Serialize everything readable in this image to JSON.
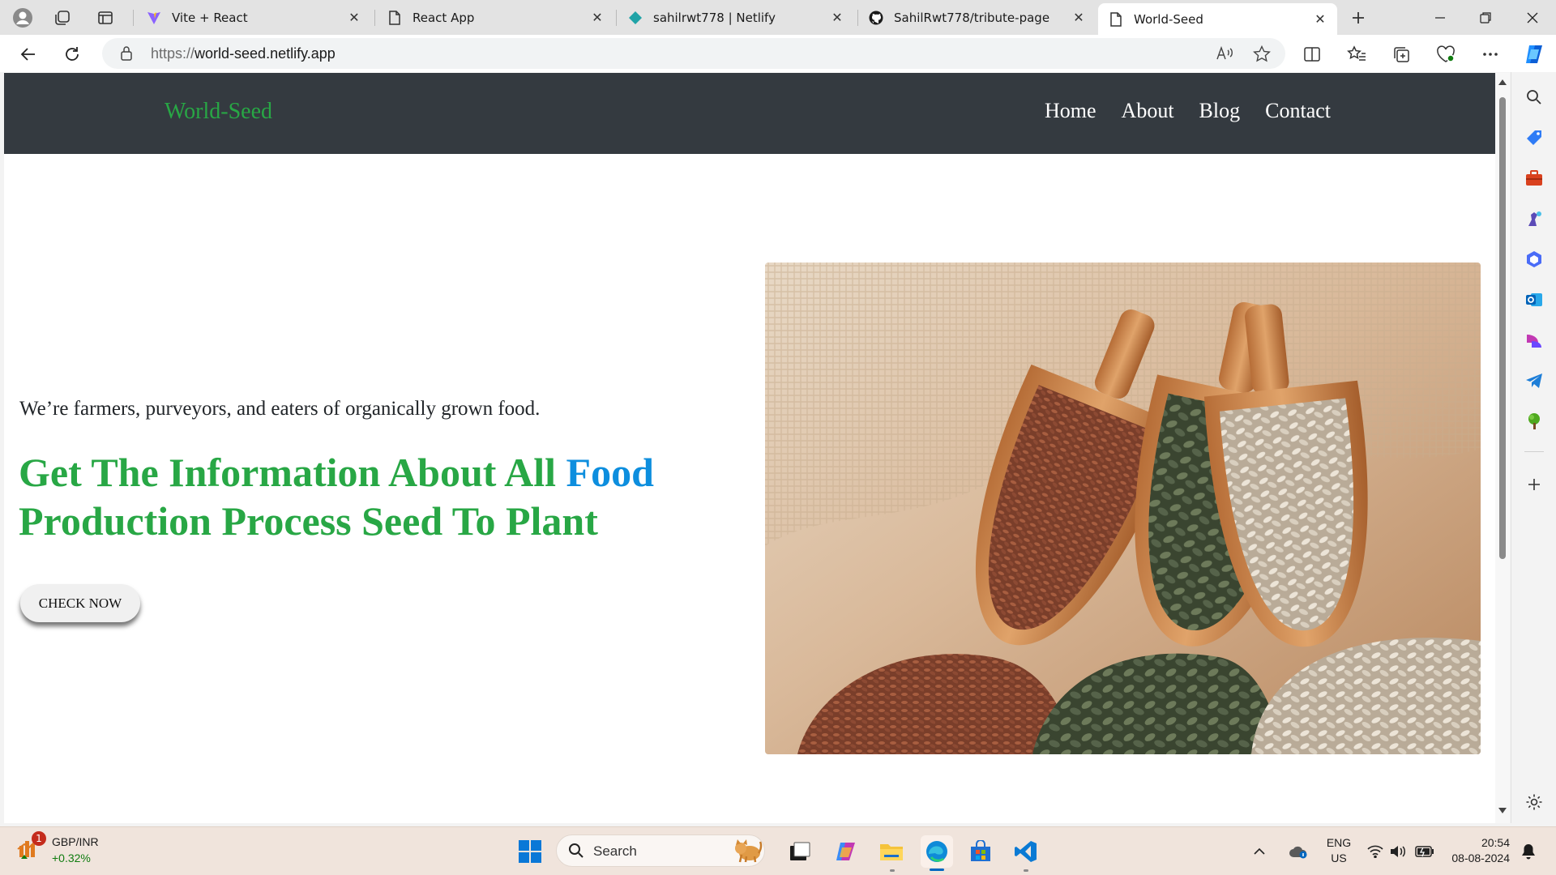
{
  "browser": {
    "tabs": [
      {
        "title": "Vite + React",
        "icon": "vite-icon"
      },
      {
        "title": "React App",
        "icon": "page-icon"
      },
      {
        "title": "sahilrwt778 | Netlify",
        "icon": "netlify-icon"
      },
      {
        "title": "SahilRwt778/tribute-page",
        "icon": "github-icon"
      },
      {
        "title": "World-Seed",
        "icon": "page-icon",
        "active": true
      }
    ],
    "url_protocol": "https://",
    "url_host": "world-seed.netlify.app"
  },
  "site": {
    "brand": "World-Seed",
    "nav": [
      "Home",
      "About",
      "Blog",
      "Contact"
    ],
    "tagline": "We’re farmers, purveyors, and eaters of organically grown food.",
    "headline_part1": "Get The Information About All ",
    "headline_highlight": "Food",
    "headline_part2": " Production Process Seed To Plant",
    "cta": "CHECK NOW",
    "colors": {
      "nav_bg": "#343a40",
      "brand": "#28a745",
      "headline": "#28a745",
      "highlight": "#0d8ede"
    }
  },
  "taskbar": {
    "stock_pair": "GBP/INR",
    "stock_change": "+0.32%",
    "stock_badge": "1",
    "search_label": "Search",
    "lang_line1": "ENG",
    "lang_line2": "US",
    "time": "20:54",
    "date": "08-08-2024"
  }
}
